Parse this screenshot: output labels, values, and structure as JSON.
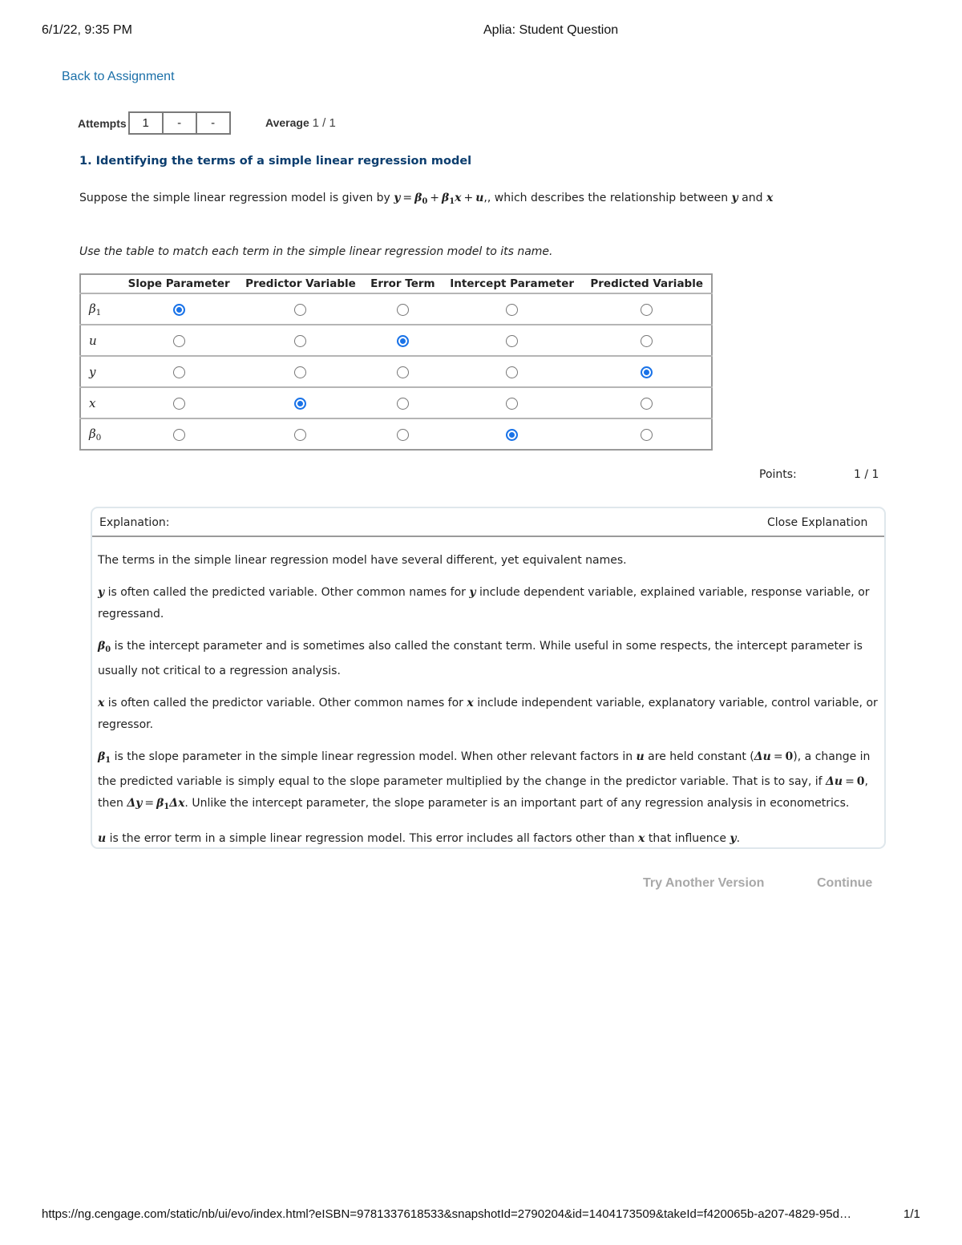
{
  "print_header": {
    "datetime": "6/1/22, 9:35 PM",
    "title": "Aplia: Student Question"
  },
  "nav": {
    "back_label": "Back to Assignment"
  },
  "attempts": {
    "label": "Attempts",
    "boxes": [
      "1",
      "-",
      "-"
    ]
  },
  "average": {
    "label": "Average",
    "value": "1 / 1"
  },
  "question": {
    "title": "1. Identifying the terms of a simple linear regression model",
    "prompt_before": "Suppose the simple linear regression model is given by ",
    "prompt_after": ", which describes the relationship between ",
    "prompt_and": " and ",
    "instruction": "Use the table to match each term in the simple linear regression model to its name."
  },
  "math": {
    "y": "y",
    "x": "x",
    "u": "u",
    "beta": "β",
    "eq": "=",
    "plus": "+",
    "sub0": "0",
    "sub1": "1",
    "comma": ",",
    "delta": "Δ",
    "zero": "0",
    "lparen": "(",
    "rparen": ")"
  },
  "table": {
    "columns": [
      "Slope Parameter",
      "Predictor Variable",
      "Error Term",
      "Intercept Parameter",
      "Predicted Variable"
    ],
    "rows": [
      {
        "term": "β1",
        "selected_column": "Slope Parameter"
      },
      {
        "term": "u",
        "selected_column": "Error Term"
      },
      {
        "term": "y",
        "selected_column": "Predicted Variable"
      },
      {
        "term": "x",
        "selected_column": "Predictor Variable"
      },
      {
        "term": "β0",
        "selected_column": "Intercept Parameter"
      }
    ],
    "selected_color": "#1a73e8"
  },
  "points": {
    "label": "Points:",
    "value": "1 / 1"
  },
  "explanation": {
    "title": "Explanation:",
    "close_label": "Close Explanation",
    "p1": "The terms in the simple linear regression model have several different, yet equivalent names.",
    "p2a": " is often called the predicted variable. Other common names for ",
    "p2b": " include dependent variable, explained variable, response variable, or regressand.",
    "p3": " is the intercept parameter and is sometimes also called the constant term. While useful in some respects, the intercept parameter is usually not critical to a regression analysis.",
    "p4a": " is often called the predictor variable. Other common names for ",
    "p4b": " include independent variable, explanatory variable, control variable, or regressor.",
    "p5a": " is the slope parameter in the simple linear regression model. When other relevant factors in ",
    "p5b": " are held constant (",
    "p5c": "), a change in the predicted variable is simply equal to the slope parameter multiplied by the change in the predictor variable. That is to say, if ",
    "p5d": ", then ",
    "p5e": ". Unlike the intercept parameter, the slope parameter is an important part of any regression analysis in econometrics.",
    "p6a": " is the error term in a simple linear regression model. This error includes all factors other than ",
    "p6b": " that influence ",
    "p6c": "."
  },
  "actions": {
    "try_another": "Try Another Version",
    "continue": "Continue"
  },
  "print_footer": {
    "url": "https://ng.cengage.com/static/nb/ui/evo/index.html?eISBN=9781337618533&snapshotId=2790204&id=1404173509&takeId=f420065b-a207-4829-95d…",
    "page": "1/1"
  }
}
